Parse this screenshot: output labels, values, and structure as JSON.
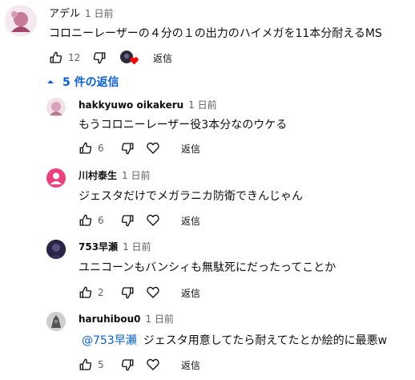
{
  "top_comment": {
    "author": "アデル",
    "time": "1 日前",
    "text": "コロニーレーザーの４分の１の出力のハイメガを11本分耐えるMS",
    "likes": "12",
    "reply_label": "返信",
    "heart_icon": "heart-icon"
  },
  "replies_toggle": {
    "label": "5 件の返信"
  },
  "replies": [
    {
      "author": "hakkyuwo oikakeru",
      "time": "1 日前",
      "mention": "",
      "text": "もうコロニーレーザー役3本分なのウケる",
      "likes": "6",
      "reply_label": "返信"
    },
    {
      "author": "川村泰生",
      "time": "1 日前",
      "mention": "",
      "text": "ジェスタだけでメガラニカ防衛できんじゃん",
      "likes": "6",
      "reply_label": "返信"
    },
    {
      "author": "753早瀬",
      "time": "1 日前",
      "mention": "",
      "text": "ユニコーンもバンシィも無駄死にだったってことか",
      "likes": "2",
      "reply_label": "返信"
    },
    {
      "author": "haruhibou0",
      "time": "1 日前",
      "mention": "@753早瀬",
      "text": "ジェスタ用意してたら耐えてたとか絵的に最悪w",
      "likes": "5",
      "reply_label": "返信"
    }
  ]
}
